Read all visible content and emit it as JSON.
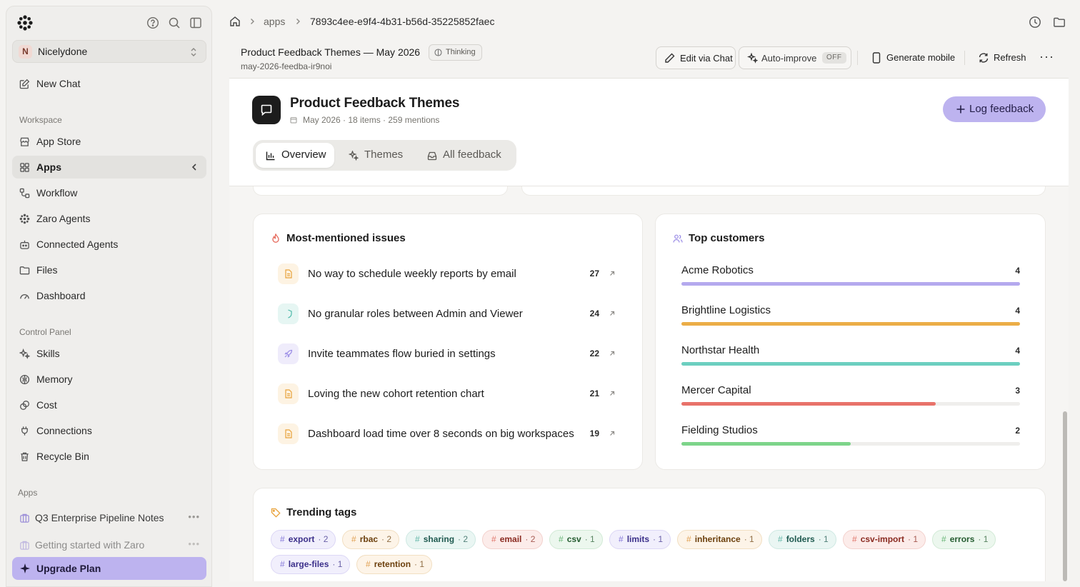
{
  "sidebar": {
    "workspace": {
      "initial": "N",
      "name": "Nicelydone"
    },
    "new_chat": "New Chat",
    "workspace_label": "Workspace",
    "workspace_items": [
      {
        "label": "App Store",
        "icon": "store-icon"
      },
      {
        "label": "Apps",
        "icon": "grid-icon",
        "active": true
      },
      {
        "label": "Workflow",
        "icon": "workflow-icon"
      },
      {
        "label": "Zaro Agents",
        "icon": "agents-icon"
      },
      {
        "label": "Connected Agents",
        "icon": "bot-icon"
      },
      {
        "label": "Files",
        "icon": "folder-icon"
      },
      {
        "label": "Dashboard",
        "icon": "gauge-icon"
      }
    ],
    "control_label": "Control Panel",
    "control_items": [
      {
        "label": "Skills",
        "icon": "sparkle-icon"
      },
      {
        "label": "Memory",
        "icon": "brain-icon"
      },
      {
        "label": "Cost",
        "icon": "coins-icon"
      },
      {
        "label": "Connections",
        "icon": "plug-icon"
      },
      {
        "label": "Recycle Bin",
        "icon": "trash-icon"
      }
    ],
    "apps_label": "Apps",
    "apps": [
      {
        "label": "Q3 Enterprise Pipeline Notes"
      },
      {
        "label": "Getting started with Zaro"
      }
    ],
    "upgrade": "Upgrade Plan"
  },
  "breadcrumb": {
    "root": "apps",
    "id": "7893c4ee-e9f4-4b31-b56d-35225852faec"
  },
  "header": {
    "title": "Product Feedback Themes — May 2026",
    "badge": "Thinking",
    "slug": "may-2026-feedba-ir9noi",
    "edit_chat": "Edit via Chat",
    "auto_improve": "Auto-improve",
    "auto_improve_state": "OFF",
    "generate_mobile": "Generate mobile",
    "refresh": "Refresh"
  },
  "app": {
    "title": "Product Feedback Themes",
    "meta": "May 2026 · 18 items · 259 mentions",
    "log_button": "Log feedback",
    "tabs": [
      {
        "label": "Overview",
        "icon": "bar-chart-icon"
      },
      {
        "label": "Themes",
        "icon": "sparkle-icon"
      },
      {
        "label": "All feedback",
        "icon": "inbox-icon"
      }
    ]
  },
  "issues": {
    "title": "Most-mentioned issues",
    "items": [
      {
        "label": "No way to schedule weekly reports by email",
        "count": "27",
        "icon": "file-icon",
        "color": "#e8a23a"
      },
      {
        "label": "No granular roles between Admin and Viewer",
        "count": "24",
        "icon": "shield-icon",
        "color": "#4cb8a8"
      },
      {
        "label": "Invite teammates flow buried in settings",
        "count": "22",
        "icon": "rocket-icon",
        "color": "#9a8ce6"
      },
      {
        "label": "Loving the new cohort retention chart",
        "count": "21",
        "icon": "file-icon",
        "color": "#e8a23a"
      },
      {
        "label": "Dashboard load time over 8 seconds on big workspaces",
        "count": "19",
        "icon": "file-icon",
        "color": "#e8a23a"
      }
    ]
  },
  "customers": {
    "title": "Top customers",
    "items": [
      {
        "name": "Acme Robotics",
        "count": "4",
        "fraction": 1.0,
        "color": "#b4a9ee"
      },
      {
        "name": "Brightline Logistics",
        "count": "4",
        "fraction": 1.0,
        "color": "#ebad47"
      },
      {
        "name": "Northstar Health",
        "count": "4",
        "fraction": 1.0,
        "color": "#6ccfc0"
      },
      {
        "name": "Mercer Capital",
        "count": "3",
        "fraction": 0.75,
        "color": "#e8726a"
      },
      {
        "name": "Fielding Studios",
        "count": "2",
        "fraction": 0.5,
        "color": "#7dd48a"
      }
    ]
  },
  "tags": {
    "title": "Trending tags",
    "items": [
      {
        "name": "export",
        "count": "2",
        "tone": "purple"
      },
      {
        "name": "rbac",
        "count": "2",
        "tone": "orange"
      },
      {
        "name": "sharing",
        "count": "2",
        "tone": "teal"
      },
      {
        "name": "email",
        "count": "2",
        "tone": "red"
      },
      {
        "name": "csv",
        "count": "1",
        "tone": "green"
      },
      {
        "name": "limits",
        "count": "1",
        "tone": "purple"
      },
      {
        "name": "inheritance",
        "count": "1",
        "tone": "orange"
      },
      {
        "name": "folders",
        "count": "1",
        "tone": "teal"
      },
      {
        "name": "csv-import",
        "count": "1",
        "tone": "red"
      },
      {
        "name": "errors",
        "count": "1",
        "tone": "green"
      },
      {
        "name": "large-files",
        "count": "1",
        "tone": "purple"
      },
      {
        "name": "retention",
        "count": "1",
        "tone": "orange"
      }
    ]
  }
}
